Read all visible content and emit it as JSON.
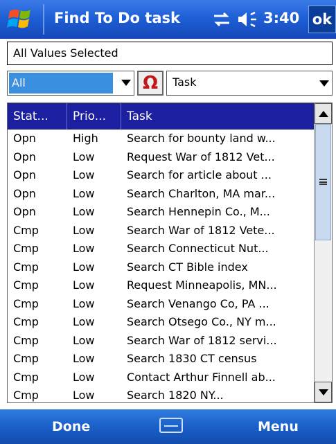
{
  "titlebar": {
    "title": "Find To Do task",
    "time": "3:40",
    "ok_label": "ok"
  },
  "filter": {
    "value": "All Values Selected"
  },
  "controls": {
    "status_filter": "All",
    "symbol_label": "Ω",
    "field_select": "Task"
  },
  "table": {
    "columns": [
      "Stat...",
      "Prio...",
      "Task"
    ],
    "rows": [
      {
        "status": "Opn",
        "priority": "High",
        "task": "Search for bounty land w..."
      },
      {
        "status": "Opn",
        "priority": "Low",
        "task": "Request War of 1812 Vet..."
      },
      {
        "status": "Opn",
        "priority": "Low",
        "task": "Search for article about ..."
      },
      {
        "status": "Opn",
        "priority": "Low",
        "task": "Search Charlton, MA mar..."
      },
      {
        "status": "Opn",
        "priority": "Low",
        "task": "Search Hennepin Co., M..."
      },
      {
        "status": "Cmp",
        "priority": "Low",
        "task": "Search War of 1812 Vete..."
      },
      {
        "status": "Cmp",
        "priority": "Low",
        "task": "Search Connecticut Nut..."
      },
      {
        "status": "Cmp",
        "priority": "Low",
        "task": "Search CT Bible index"
      },
      {
        "status": "Cmp",
        "priority": "Low",
        "task": "Request Minneapolis, MN..."
      },
      {
        "status": "Cmp",
        "priority": "Low",
        "task": "Search Venango Co, PA ..."
      },
      {
        "status": "Cmp",
        "priority": "Low",
        "task": "Search Otsego Co., NY m..."
      },
      {
        "status": "Cmp",
        "priority": "Low",
        "task": "Search War of 1812 servi..."
      },
      {
        "status": "Cmp",
        "priority": "Low",
        "task": "Search 1830 CT census"
      },
      {
        "status": "Cmp",
        "priority": "Low",
        "task": "Contact Arthur Finnell ab..."
      },
      {
        "status": "Cmp",
        "priority": "Low",
        "task": "Search 1820 NY..."
      }
    ]
  },
  "softkeys": {
    "left": "Done",
    "right": "Menu"
  },
  "colors": {
    "titlebar": "#1f5fd6",
    "header": "#1b1fa0",
    "selection": "#3a8fe0",
    "softbar": "#1a5fc8"
  },
  "icons": [
    "windows-start-icon",
    "connectivity-icon",
    "volume-icon",
    "omega-icon",
    "keyboard-icon"
  ]
}
